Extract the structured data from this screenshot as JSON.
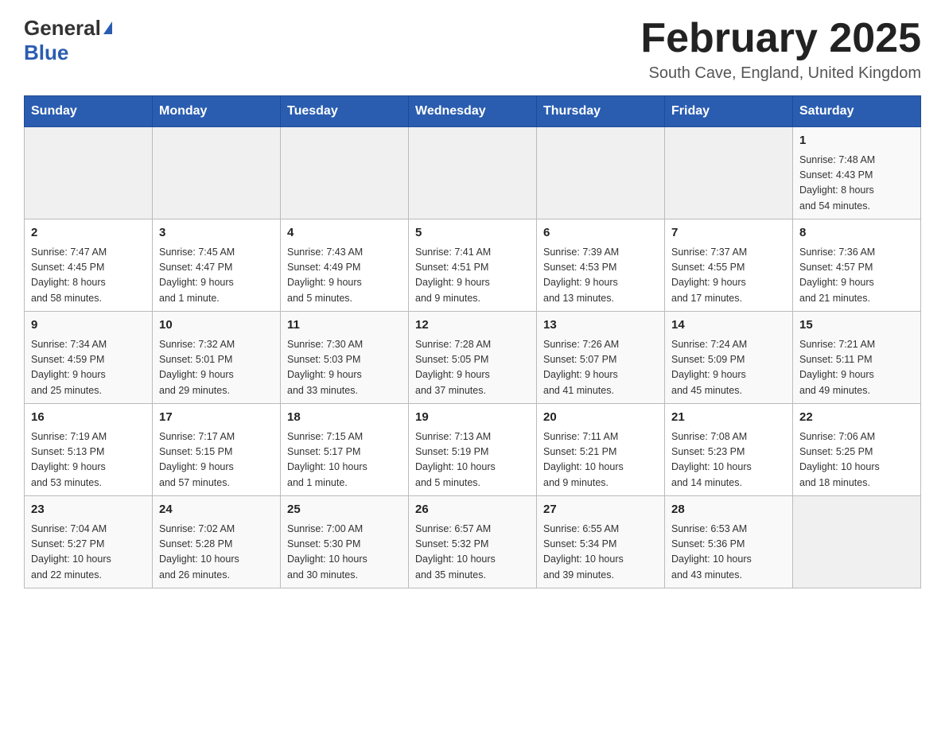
{
  "header": {
    "logo_general": "General",
    "logo_blue": "Blue",
    "month_title": "February 2025",
    "location": "South Cave, England, United Kingdom"
  },
  "days_of_week": [
    "Sunday",
    "Monday",
    "Tuesday",
    "Wednesday",
    "Thursday",
    "Friday",
    "Saturday"
  ],
  "weeks": [
    [
      {
        "day": "",
        "info": ""
      },
      {
        "day": "",
        "info": ""
      },
      {
        "day": "",
        "info": ""
      },
      {
        "day": "",
        "info": ""
      },
      {
        "day": "",
        "info": ""
      },
      {
        "day": "",
        "info": ""
      },
      {
        "day": "1",
        "info": "Sunrise: 7:48 AM\nSunset: 4:43 PM\nDaylight: 8 hours\nand 54 minutes."
      }
    ],
    [
      {
        "day": "2",
        "info": "Sunrise: 7:47 AM\nSunset: 4:45 PM\nDaylight: 8 hours\nand 58 minutes."
      },
      {
        "day": "3",
        "info": "Sunrise: 7:45 AM\nSunset: 4:47 PM\nDaylight: 9 hours\nand 1 minute."
      },
      {
        "day": "4",
        "info": "Sunrise: 7:43 AM\nSunset: 4:49 PM\nDaylight: 9 hours\nand 5 minutes."
      },
      {
        "day": "5",
        "info": "Sunrise: 7:41 AM\nSunset: 4:51 PM\nDaylight: 9 hours\nand 9 minutes."
      },
      {
        "day": "6",
        "info": "Sunrise: 7:39 AM\nSunset: 4:53 PM\nDaylight: 9 hours\nand 13 minutes."
      },
      {
        "day": "7",
        "info": "Sunrise: 7:37 AM\nSunset: 4:55 PM\nDaylight: 9 hours\nand 17 minutes."
      },
      {
        "day": "8",
        "info": "Sunrise: 7:36 AM\nSunset: 4:57 PM\nDaylight: 9 hours\nand 21 minutes."
      }
    ],
    [
      {
        "day": "9",
        "info": "Sunrise: 7:34 AM\nSunset: 4:59 PM\nDaylight: 9 hours\nand 25 minutes."
      },
      {
        "day": "10",
        "info": "Sunrise: 7:32 AM\nSunset: 5:01 PM\nDaylight: 9 hours\nand 29 minutes."
      },
      {
        "day": "11",
        "info": "Sunrise: 7:30 AM\nSunset: 5:03 PM\nDaylight: 9 hours\nand 33 minutes."
      },
      {
        "day": "12",
        "info": "Sunrise: 7:28 AM\nSunset: 5:05 PM\nDaylight: 9 hours\nand 37 minutes."
      },
      {
        "day": "13",
        "info": "Sunrise: 7:26 AM\nSunset: 5:07 PM\nDaylight: 9 hours\nand 41 minutes."
      },
      {
        "day": "14",
        "info": "Sunrise: 7:24 AM\nSunset: 5:09 PM\nDaylight: 9 hours\nand 45 minutes."
      },
      {
        "day": "15",
        "info": "Sunrise: 7:21 AM\nSunset: 5:11 PM\nDaylight: 9 hours\nand 49 minutes."
      }
    ],
    [
      {
        "day": "16",
        "info": "Sunrise: 7:19 AM\nSunset: 5:13 PM\nDaylight: 9 hours\nand 53 minutes."
      },
      {
        "day": "17",
        "info": "Sunrise: 7:17 AM\nSunset: 5:15 PM\nDaylight: 9 hours\nand 57 minutes."
      },
      {
        "day": "18",
        "info": "Sunrise: 7:15 AM\nSunset: 5:17 PM\nDaylight: 10 hours\nand 1 minute."
      },
      {
        "day": "19",
        "info": "Sunrise: 7:13 AM\nSunset: 5:19 PM\nDaylight: 10 hours\nand 5 minutes."
      },
      {
        "day": "20",
        "info": "Sunrise: 7:11 AM\nSunset: 5:21 PM\nDaylight: 10 hours\nand 9 minutes."
      },
      {
        "day": "21",
        "info": "Sunrise: 7:08 AM\nSunset: 5:23 PM\nDaylight: 10 hours\nand 14 minutes."
      },
      {
        "day": "22",
        "info": "Sunrise: 7:06 AM\nSunset: 5:25 PM\nDaylight: 10 hours\nand 18 minutes."
      }
    ],
    [
      {
        "day": "23",
        "info": "Sunrise: 7:04 AM\nSunset: 5:27 PM\nDaylight: 10 hours\nand 22 minutes."
      },
      {
        "day": "24",
        "info": "Sunrise: 7:02 AM\nSunset: 5:28 PM\nDaylight: 10 hours\nand 26 minutes."
      },
      {
        "day": "25",
        "info": "Sunrise: 7:00 AM\nSunset: 5:30 PM\nDaylight: 10 hours\nand 30 minutes."
      },
      {
        "day": "26",
        "info": "Sunrise: 6:57 AM\nSunset: 5:32 PM\nDaylight: 10 hours\nand 35 minutes."
      },
      {
        "day": "27",
        "info": "Sunrise: 6:55 AM\nSunset: 5:34 PM\nDaylight: 10 hours\nand 39 minutes."
      },
      {
        "day": "28",
        "info": "Sunrise: 6:53 AM\nSunset: 5:36 PM\nDaylight: 10 hours\nand 43 minutes."
      },
      {
        "day": "",
        "info": ""
      }
    ]
  ]
}
